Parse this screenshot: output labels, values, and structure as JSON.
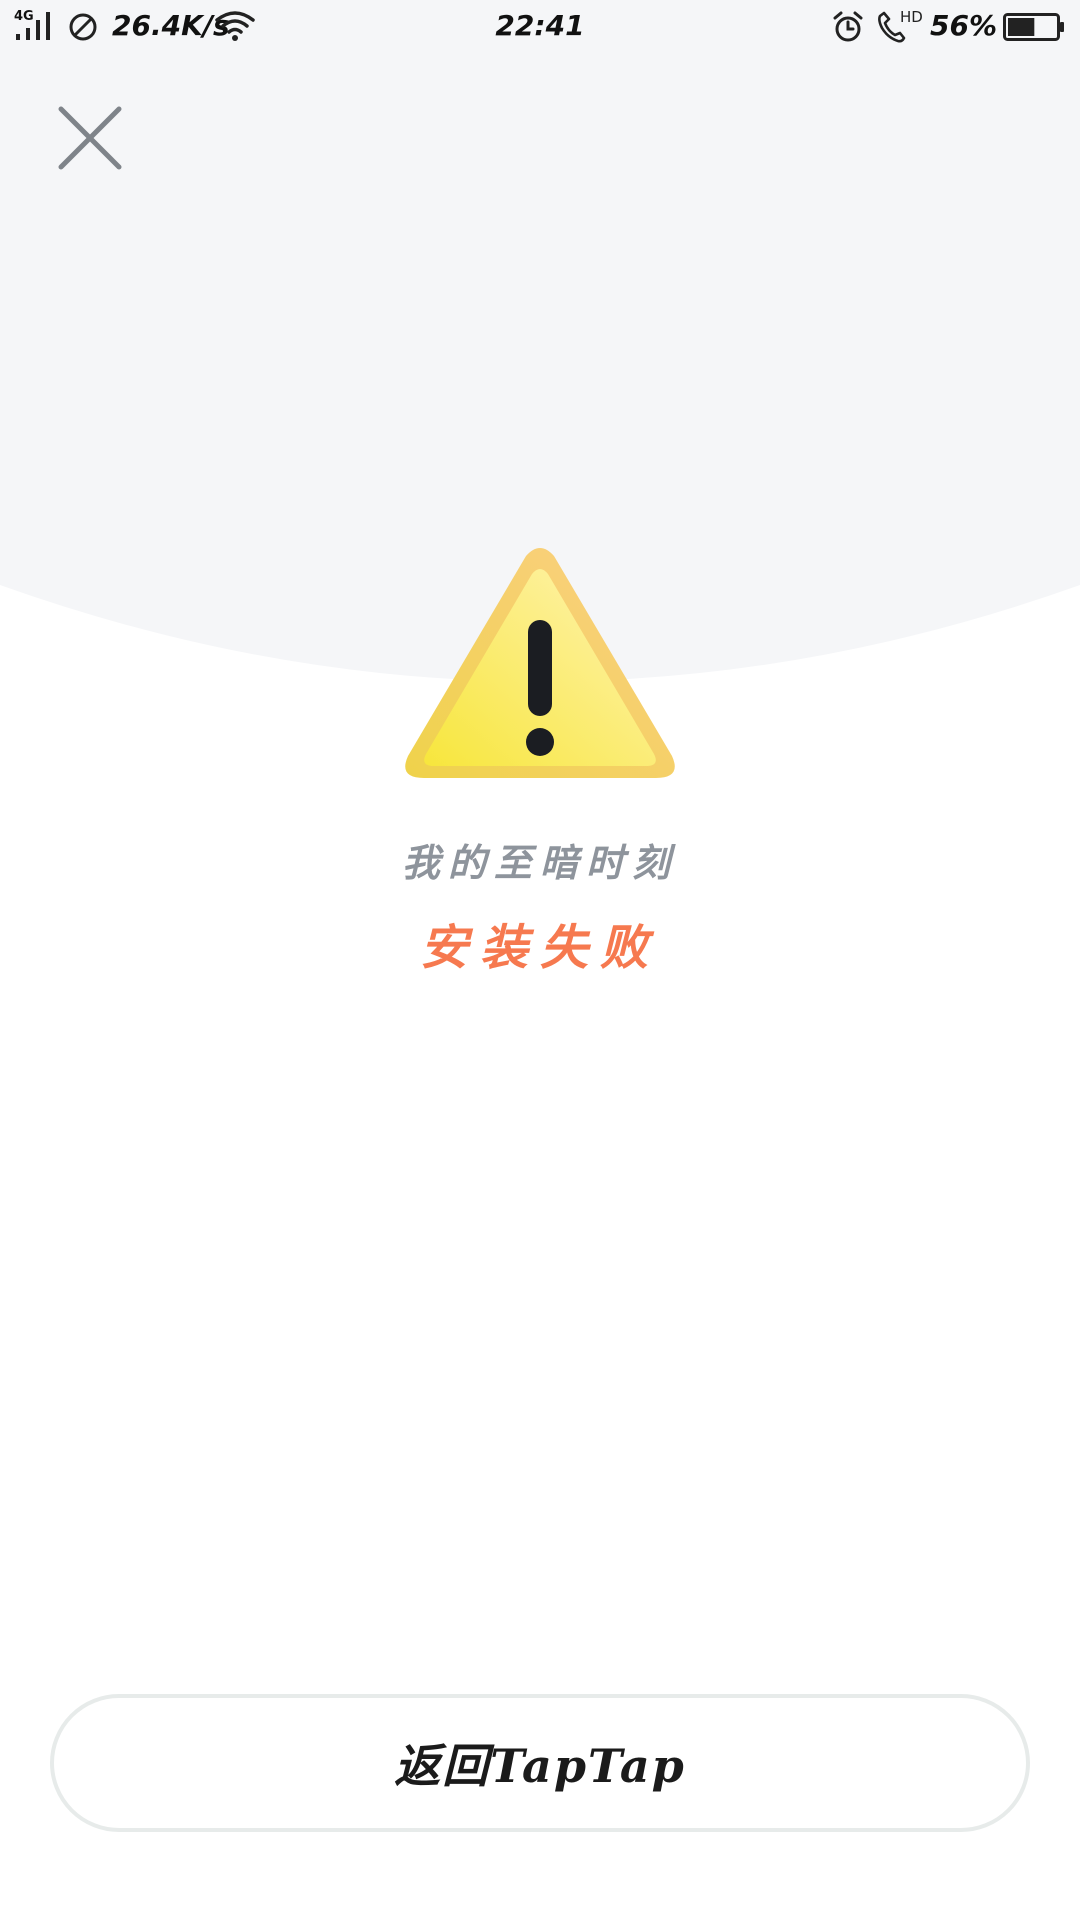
{
  "status_bar": {
    "network_label": "4G",
    "net_speed": "26.4K/s",
    "time": "22:41",
    "call_label": "HD",
    "battery_percent": "56%",
    "battery_level": 0.56
  },
  "icons": {
    "close": "close-icon",
    "warning": "warning-triangle-icon"
  },
  "colors": {
    "top_background": "#f5f6f8",
    "accent_orange": "#f6794f",
    "muted_text": "#8e949c",
    "warning_yellow": "#f6e84a"
  },
  "main": {
    "app_name": "我的至暗时刻",
    "install_status": "安装失败"
  },
  "bottom": {
    "return_label": "返回TapTap"
  }
}
